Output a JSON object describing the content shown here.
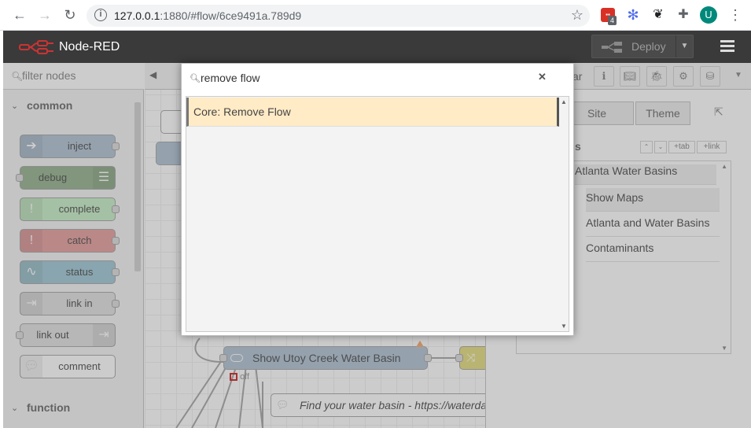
{
  "browser": {
    "url_host": "127.0.0.1",
    "url_rest": ":1880/#flow/6ce9491a.789d9",
    "ext_badge": "4",
    "avatar_letter": "U"
  },
  "app": {
    "title": "Node-RED",
    "deploy_label": "Deploy"
  },
  "palette": {
    "filter_placeholder": "filter nodes",
    "categories": [
      "common",
      "function"
    ],
    "nodes": [
      {
        "label": "inject",
        "color": "#a6bbcf"
      },
      {
        "label": "debug",
        "color": "#87a980"
      },
      {
        "label": "complete",
        "color": "#c0edc0"
      },
      {
        "label": "catch",
        "color": "#e49191"
      },
      {
        "label": "status",
        "color": "#94c1d0"
      },
      {
        "label": "link in",
        "color": "#dddddd"
      },
      {
        "label": "link out",
        "color": "#dddddd"
      },
      {
        "label": "comment",
        "color": "#ffffff"
      }
    ]
  },
  "canvas": {
    "node_utoy": "Show Utoy Creek Water Basin",
    "node_utoy_status": "off",
    "comment_node": "Find your water basin - https://waterda"
  },
  "sidebar": {
    "header_fragment": "ar",
    "tabs": [
      "Site",
      "Theme"
    ],
    "section_fragment": "s",
    "tab_btn": "tab",
    "link_btn": "link",
    "items": [
      "Atlanta Water Basins",
      "Show Maps",
      "Atlanta and Water Basins",
      "Contaminants"
    ]
  },
  "search": {
    "query": "remove flow",
    "results": [
      {
        "label": "Core: Remove Flow"
      }
    ]
  }
}
